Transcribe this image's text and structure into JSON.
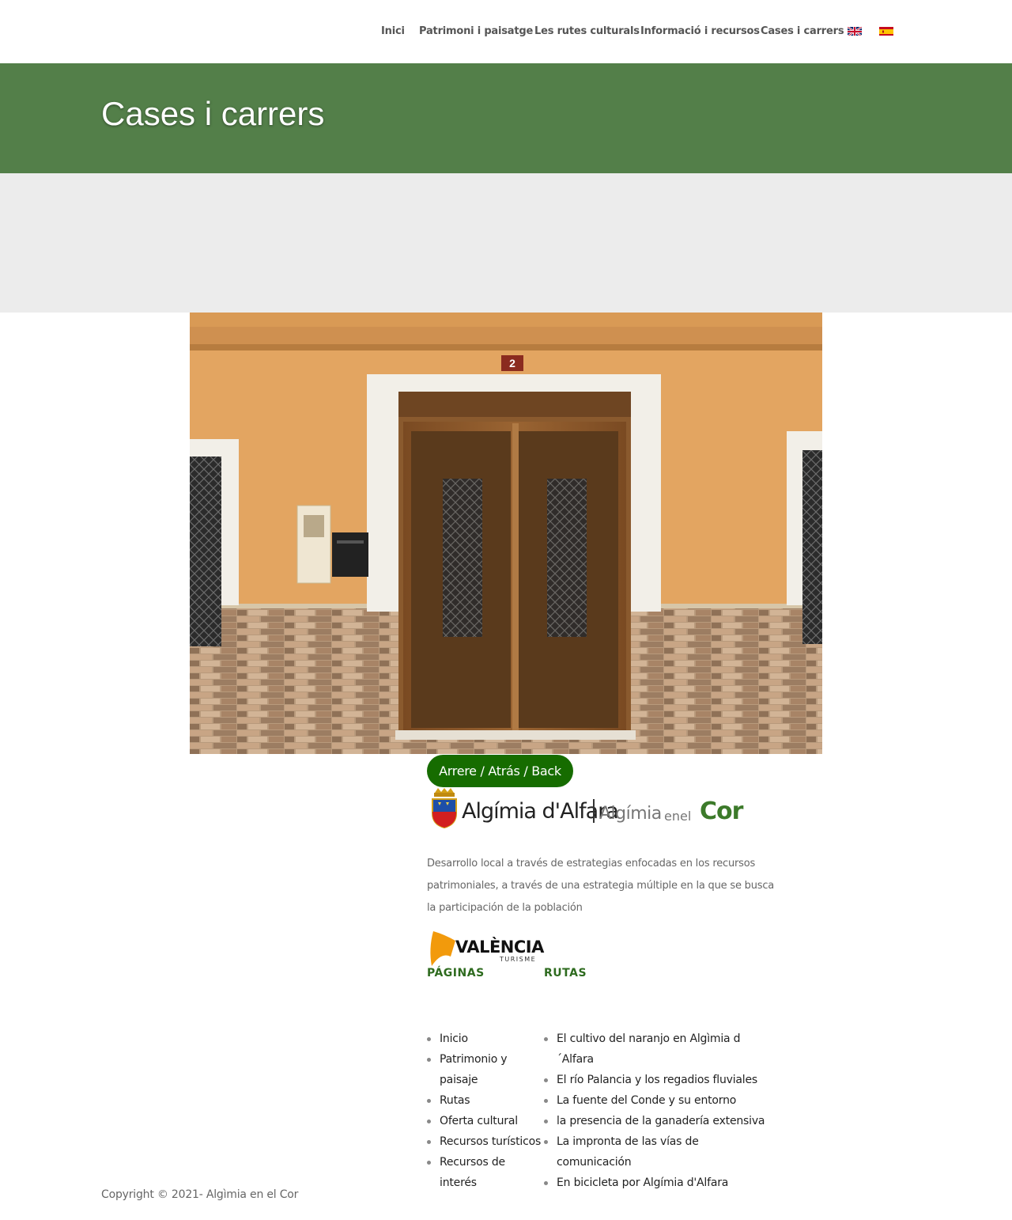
{
  "nav": {
    "items": [
      {
        "label": "Inici"
      },
      {
        "label": "Patrimoni i paisatge"
      },
      {
        "label": "Les rutes culturals"
      },
      {
        "label": "Informació i recursos"
      },
      {
        "label": "Cases i carrers"
      }
    ],
    "languages": [
      {
        "icon": "uk-flag-icon"
      },
      {
        "icon": "spain-flag-icon"
      }
    ]
  },
  "banner": {
    "title": "Cases i carrers",
    "color": "#537f49"
  },
  "photo": {
    "house_number": "2"
  },
  "back_button": {
    "label": "Arrere / Atrás / Back",
    "color": "#166c00"
  },
  "logo": {
    "town": "Algímia d'Alfara",
    "brand_prefix": "Algímia",
    "brand_middle": "enel",
    "brand_suffix": "Cor"
  },
  "description": "Desarrollo local a través de estrategias enfocadas en los recursos patrimoniales, a través de  una estrategia múltiple en la que se busca la participación de la población",
  "valencia_logo": {
    "name": "VALÈNCIA",
    "sub": "TURISME"
  },
  "footer": {
    "pages_heading": "PÁGINAS",
    "routes_heading": "RUTAS",
    "pages": [
      {
        "label": "Inicio"
      },
      {
        "label": "Patrimonio y paisaje"
      },
      {
        "label": "Rutas"
      },
      {
        "label": "Oferta cultural"
      },
      {
        "label": "Recursos turísticos"
      },
      {
        "label": "Recursos de interés"
      }
    ],
    "routes": [
      {
        "label": "El cultivo del naranjo en Algìmia d´Alfara"
      },
      {
        "label": "El río Palancia y los regadios fluviales"
      },
      {
        "label": "La fuente del Conde y su entorno"
      },
      {
        "label": "la presencia de la ganadería extensiva"
      },
      {
        "label": "La impronta de las vías de comunicación"
      },
      {
        "label": "En bicicleta por Algímia d'Alfara"
      }
    ],
    "copyright": "Copyright © 2021- Algìmia en el Cor"
  }
}
